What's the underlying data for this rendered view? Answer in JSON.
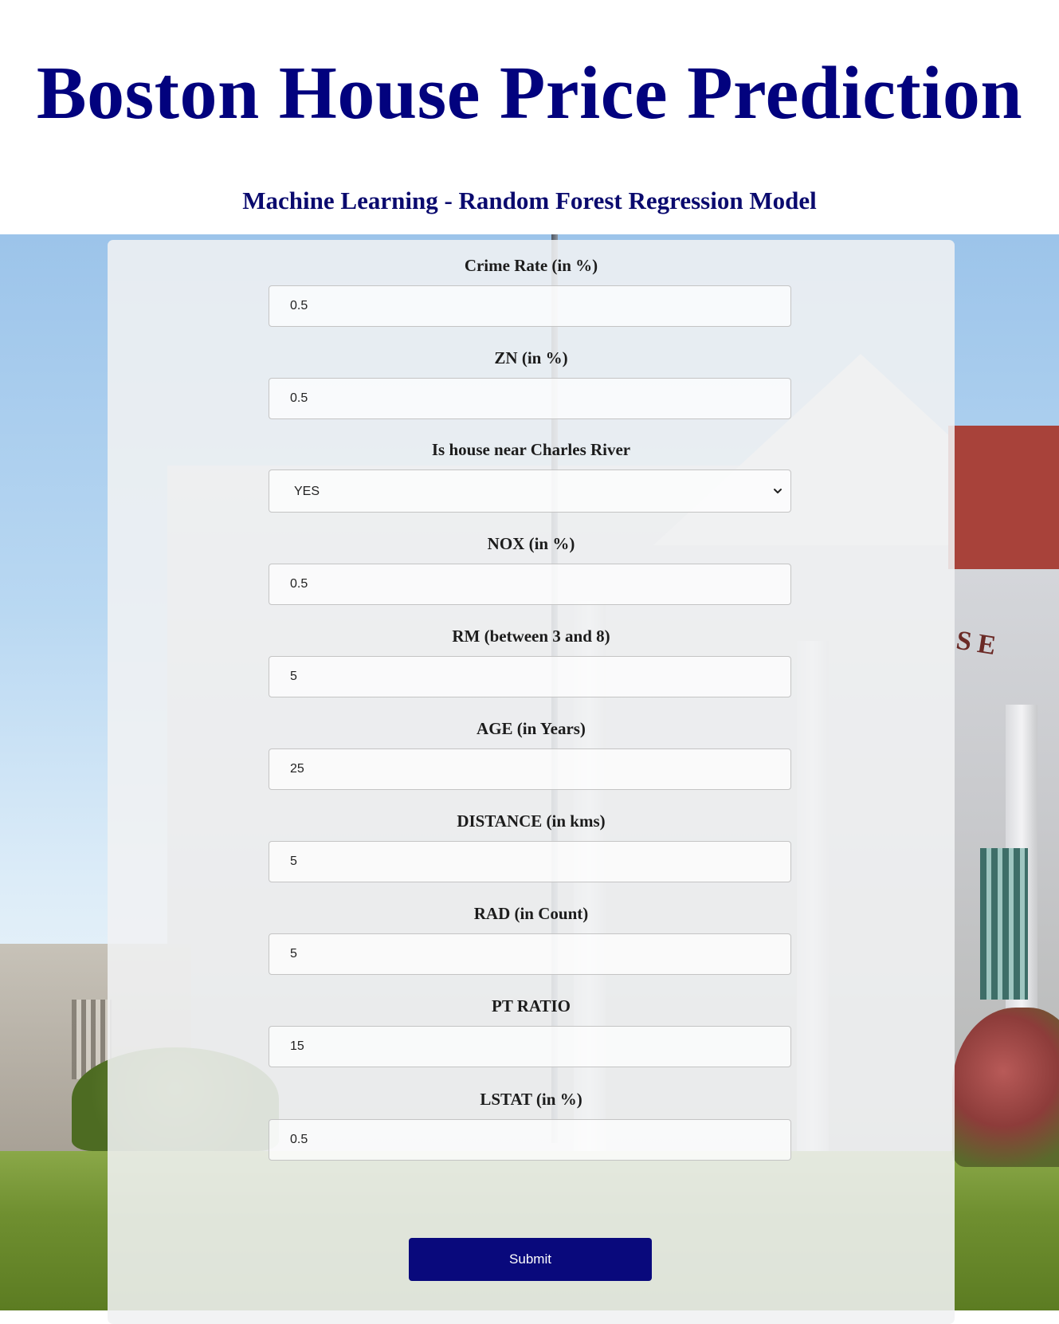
{
  "header": {
    "title": "Boston House Price Prediction",
    "subtitle": "Machine Learning - Random Forest Regression Model"
  },
  "background": {
    "sign_text": "SE"
  },
  "form": {
    "fields": [
      {
        "label": "Crime Rate (in %)",
        "value": "0.5"
      },
      {
        "label": "ZN (in %)",
        "value": "0.5"
      },
      {
        "label": "Is house near Charles River",
        "value": "YES"
      },
      {
        "label": "NOX (in %)",
        "value": "0.5"
      },
      {
        "label": "RM (between 3 and 8)",
        "value": "5"
      },
      {
        "label": "AGE (in Years)",
        "value": "25"
      },
      {
        "label": "DISTANCE (in kms)",
        "value": "5"
      },
      {
        "label": "RAD (in Count)",
        "value": "5"
      },
      {
        "label": "PT RATIO",
        "value": "15"
      },
      {
        "label": "LSTAT (in %)",
        "value": "0.5"
      }
    ],
    "submit_label": "Submit"
  },
  "colors": {
    "title": "#02027e",
    "submit_bg": "#09097c"
  },
  "icons": {
    "select_arrow": "chevron-down-icon"
  }
}
